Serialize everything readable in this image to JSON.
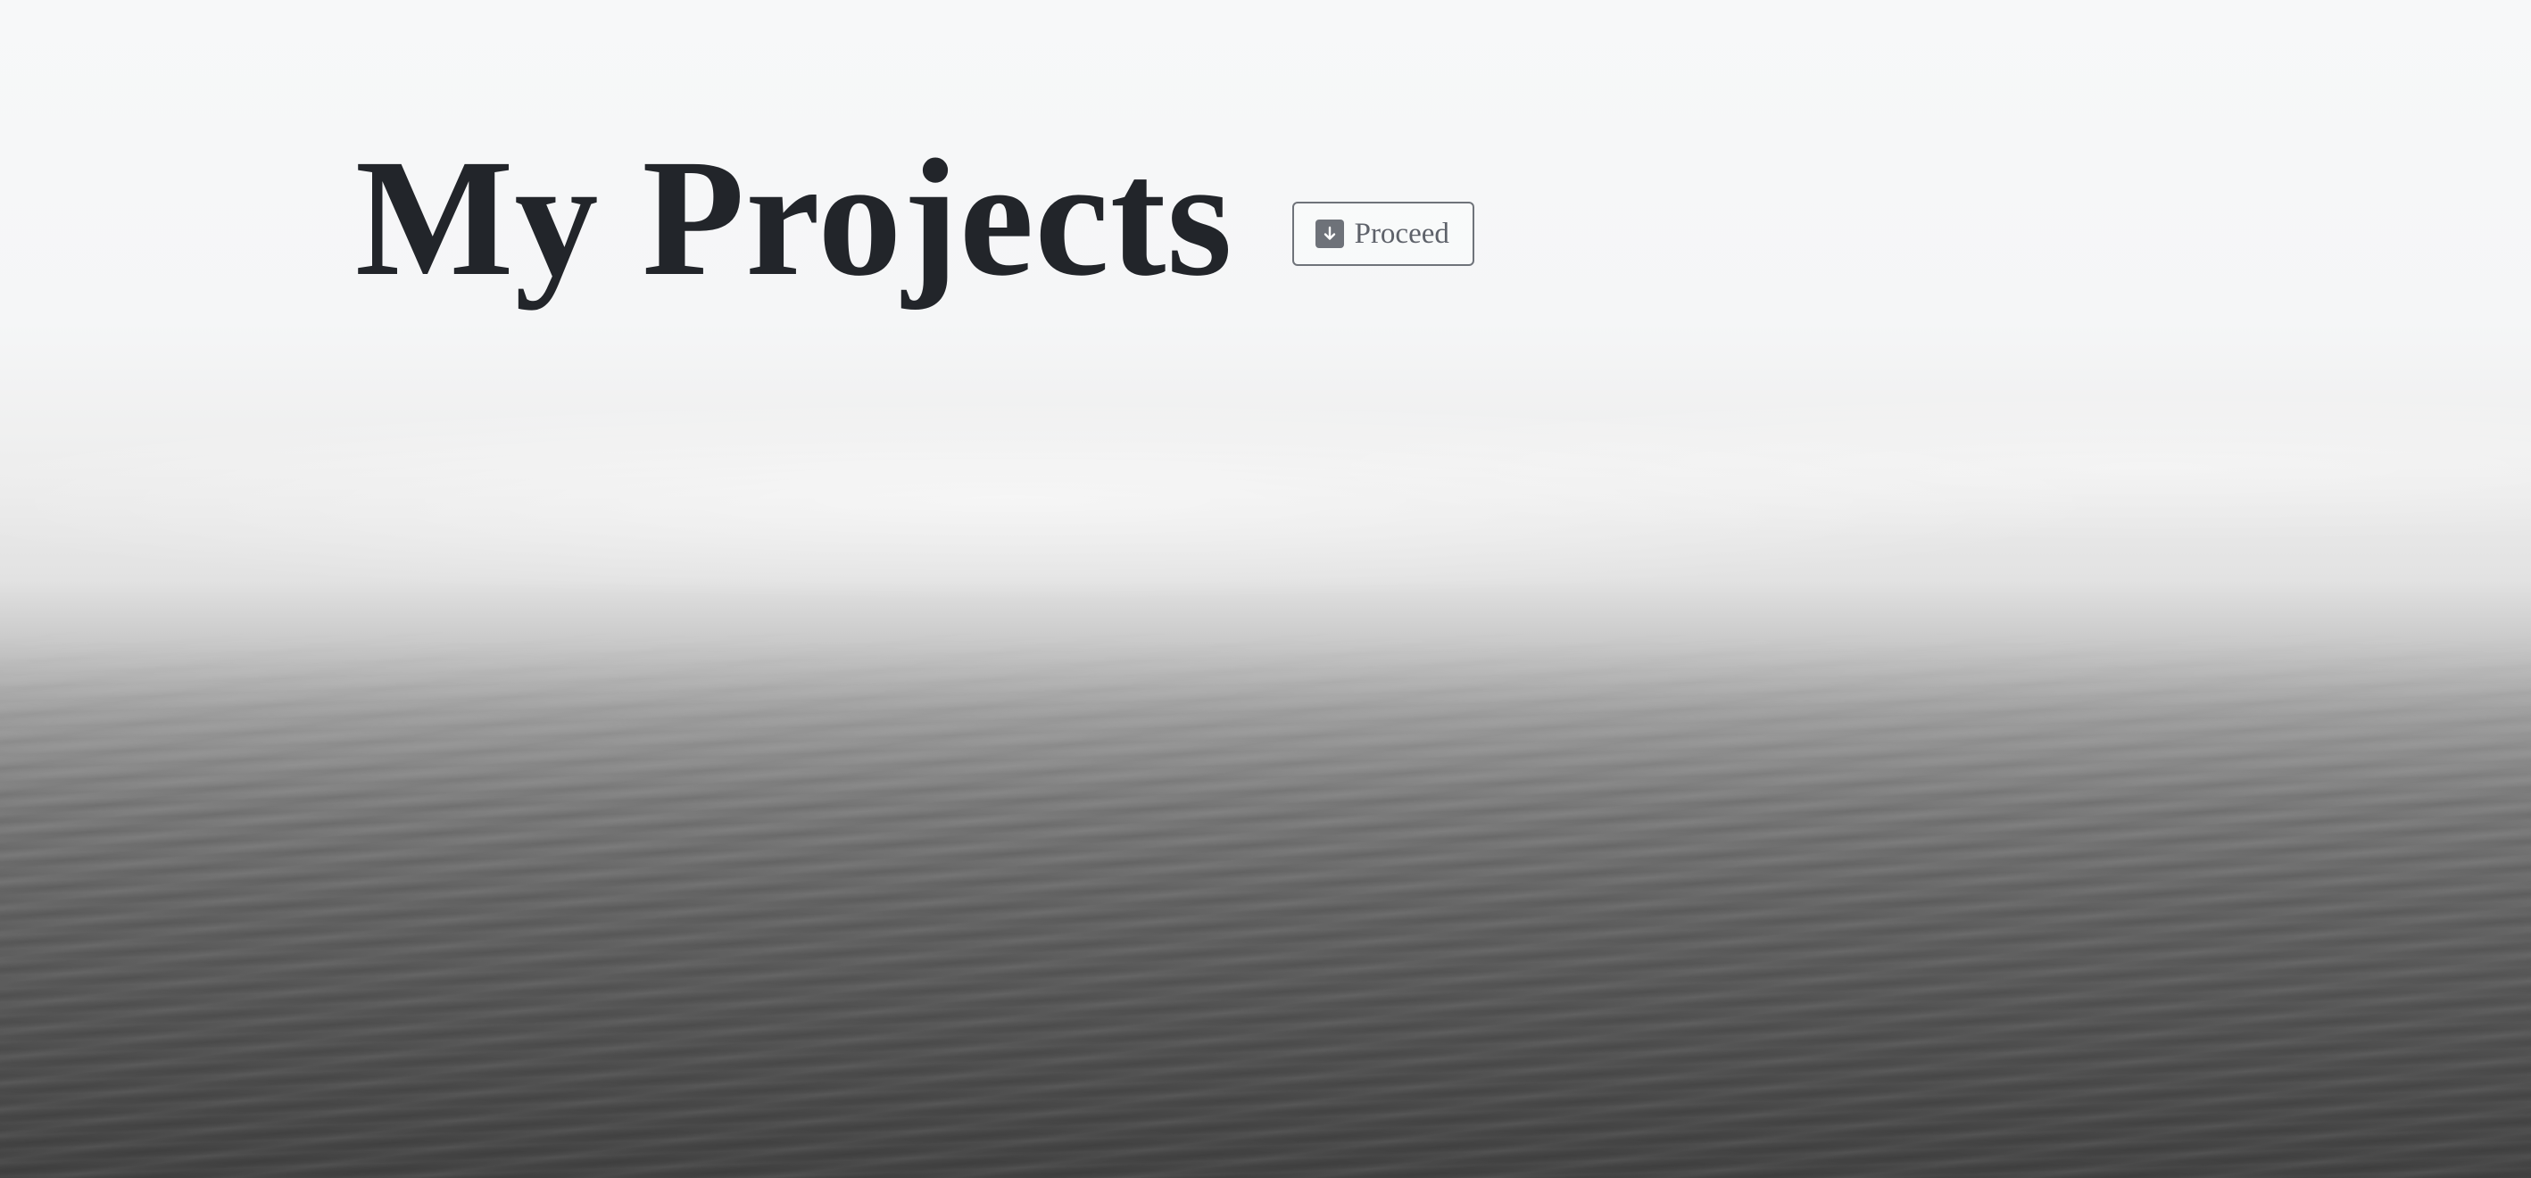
{
  "page": {
    "title": "My Projects"
  },
  "actions": {
    "proceed_label": "Proceed",
    "proceed_icon": "arrow-down-icon"
  },
  "colors": {
    "title": "#22252a",
    "button_border": "#6f737a",
    "button_text": "#5e626a",
    "sky": "#f7f8f9",
    "sea": "#444444"
  },
  "background": {
    "icon": "foggy-sea-image"
  }
}
